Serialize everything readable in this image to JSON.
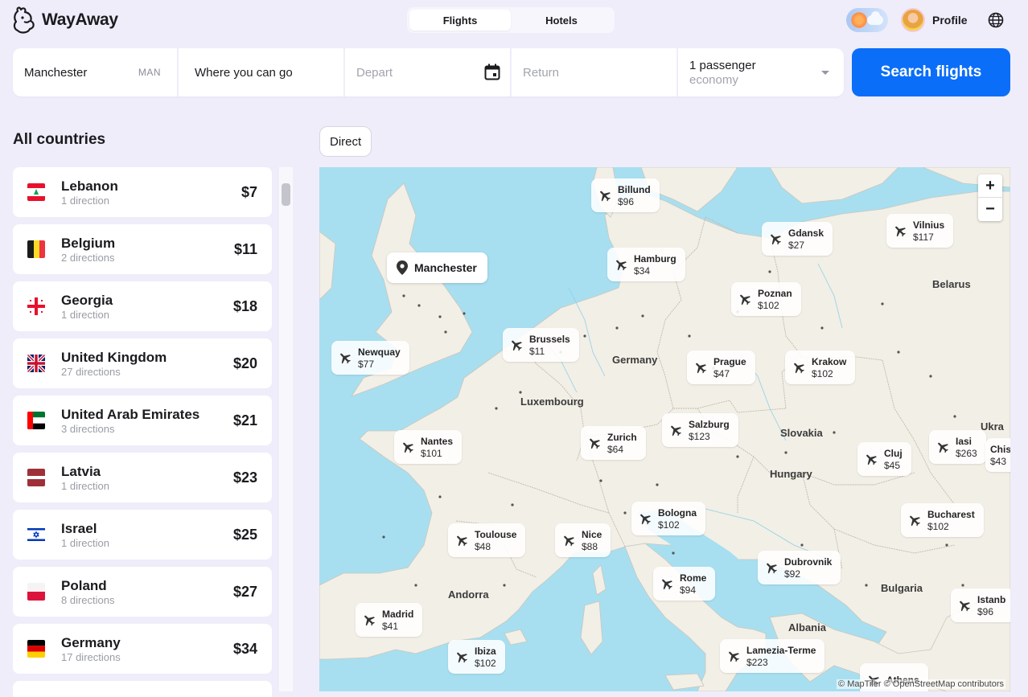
{
  "header": {
    "brand": "WayAway",
    "tabs": [
      {
        "label": "Flights",
        "active": true
      },
      {
        "label": "Hotels",
        "active": false
      }
    ],
    "profile_label": "Profile",
    "icons": [
      "logo-icon",
      "weather-toggle-icon",
      "avatar",
      "globe-icon"
    ]
  },
  "search": {
    "origin": {
      "value": "Manchester",
      "code": "MAN"
    },
    "destination": {
      "value": "Where you can go"
    },
    "depart": {
      "placeholder": "Depart"
    },
    "return": {
      "placeholder": "Return"
    },
    "passengers": {
      "value": "1 passenger",
      "cabin": "economy"
    },
    "button_label": "Search flights"
  },
  "sidebar": {
    "title": "All countries",
    "countries": [
      {
        "name": "Lebanon",
        "sub": "1 direction",
        "price": "$7",
        "flag": "lb"
      },
      {
        "name": "Belgium",
        "sub": "2 directions",
        "price": "$11",
        "flag": "be"
      },
      {
        "name": "Georgia",
        "sub": "1 direction",
        "price": "$18",
        "flag": "ge"
      },
      {
        "name": "United Kingdom",
        "sub": "27 directions",
        "price": "$20",
        "flag": "gb"
      },
      {
        "name": "United Arab Emirates",
        "sub": "3 directions",
        "price": "$21",
        "flag": "ae"
      },
      {
        "name": "Latvia",
        "sub": "1 direction",
        "price": "$23",
        "flag": "lv"
      },
      {
        "name": "Israel",
        "sub": "1 direction",
        "price": "$25",
        "flag": "il"
      },
      {
        "name": "Poland",
        "sub": "8 directions",
        "price": "$27",
        "flag": "pl"
      },
      {
        "name": "Germany",
        "sub": "17 directions",
        "price": "$34",
        "flag": "de"
      }
    ]
  },
  "filters": {
    "direct_label": "Direct"
  },
  "map": {
    "origin_label": "Manchester",
    "zoom_in": "+",
    "zoom_out": "−",
    "attribution": "© MapTiler © OpenStreetMap contributors",
    "place_labels": [
      "Germany",
      "Luxembourg",
      "Belarus",
      "Slovakia",
      "Hungary",
      "Andorra",
      "Bulgaria",
      "Albania",
      "Ukra"
    ],
    "destinations": [
      {
        "city": "Billund",
        "price": "$96"
      },
      {
        "city": "Gdansk",
        "price": "$27"
      },
      {
        "city": "Vilnius",
        "price": "$117"
      },
      {
        "city": "Hamburg",
        "price": "$34"
      },
      {
        "city": "Poznan",
        "price": "$102"
      },
      {
        "city": "Brussels",
        "price": "$11"
      },
      {
        "city": "Newquay",
        "price": "$77"
      },
      {
        "city": "Prague",
        "price": "$47"
      },
      {
        "city": "Krakow",
        "price": "$102"
      },
      {
        "city": "Salzburg",
        "price": "$123"
      },
      {
        "city": "Nantes",
        "price": "$101"
      },
      {
        "city": "Zurich",
        "price": "$64"
      },
      {
        "city": "Cluj",
        "price": "$45"
      },
      {
        "city": "Iasi",
        "price": "$263"
      },
      {
        "city": "Chisin",
        "price": "$43"
      },
      {
        "city": "Bologna",
        "price": "$102"
      },
      {
        "city": "Bucharest",
        "price": "$102"
      },
      {
        "city": "Toulouse",
        "price": "$48"
      },
      {
        "city": "Nice",
        "price": "$88"
      },
      {
        "city": "Dubrovnik",
        "price": "$92"
      },
      {
        "city": "Rome",
        "price": "$94"
      },
      {
        "city": "Istanb",
        "price": "$96"
      },
      {
        "city": "Madrid",
        "price": "$41"
      },
      {
        "city": "Ibiza",
        "price": "$102"
      },
      {
        "city": "Lamezia-Terme",
        "price": "$223"
      },
      {
        "city": "Athens",
        "price": ""
      }
    ]
  },
  "colors": {
    "accent": "#0a6ef8",
    "page_bg": "#efedfa",
    "sea": "#a7dff0",
    "land": "#f2efe6"
  }
}
